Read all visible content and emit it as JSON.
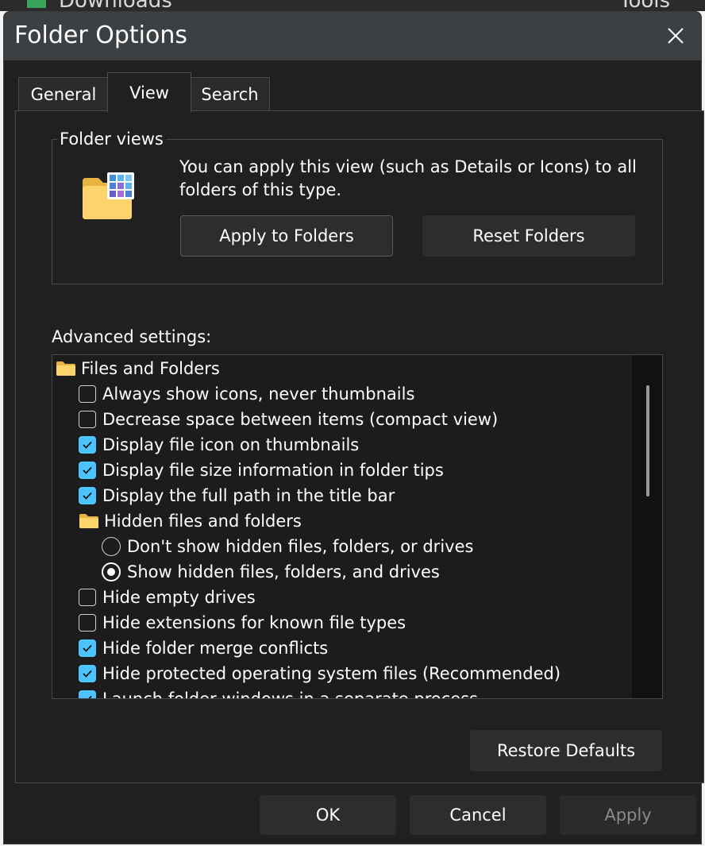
{
  "backdrop": {
    "title": "Downloads",
    "right_text": "Tools"
  },
  "window": {
    "title": "Folder Options"
  },
  "tabs": [
    {
      "label": "General",
      "active": false
    },
    {
      "label": "View",
      "active": true
    },
    {
      "label": "Search",
      "active": false
    }
  ],
  "folder_views": {
    "label": "Folder views",
    "description": "You can apply this view (such as Details or Icons) to all folders of this type.",
    "apply_button": "Apply to Folders",
    "reset_button": "Reset Folders"
  },
  "advanced": {
    "label": "Advanced settings:",
    "items": [
      {
        "type": "folder",
        "label": "Files and Folders",
        "level": 0
      },
      {
        "type": "checkbox",
        "label": "Always show icons, never thumbnails",
        "checked": false,
        "level": 1
      },
      {
        "type": "checkbox",
        "label": "Decrease space between items (compact view)",
        "checked": false,
        "level": 1
      },
      {
        "type": "checkbox",
        "label": "Display file icon on thumbnails",
        "checked": true,
        "level": 1
      },
      {
        "type": "checkbox",
        "label": "Display file size information in folder tips",
        "checked": true,
        "level": 1
      },
      {
        "type": "checkbox",
        "label": "Display the full path in the title bar",
        "checked": true,
        "level": 1
      },
      {
        "type": "folder",
        "label": "Hidden files and folders",
        "level": 1
      },
      {
        "type": "radio",
        "label": "Don't show hidden files, folders, or drives",
        "checked": false,
        "level": 2
      },
      {
        "type": "radio",
        "label": "Show hidden files, folders, and drives",
        "checked": true,
        "level": 2
      },
      {
        "type": "checkbox",
        "label": "Hide empty drives",
        "checked": false,
        "level": 1
      },
      {
        "type": "checkbox",
        "label": "Hide extensions for known file types",
        "checked": false,
        "level": 1
      },
      {
        "type": "checkbox",
        "label": "Hide folder merge conflicts",
        "checked": true,
        "level": 1
      },
      {
        "type": "checkbox",
        "label": "Hide protected operating system files (Recommended)",
        "checked": true,
        "level": 1
      },
      {
        "type": "checkbox",
        "label": "Launch folder windows in a separate process",
        "checked": true,
        "level": 1
      }
    ]
  },
  "restore_defaults": "Restore Defaults",
  "footer": {
    "ok": "OK",
    "cancel": "Cancel",
    "apply": "Apply"
  },
  "colors": {
    "accent": "#4cc2ff",
    "background": "#202020",
    "titlebar": "#3c4043"
  }
}
